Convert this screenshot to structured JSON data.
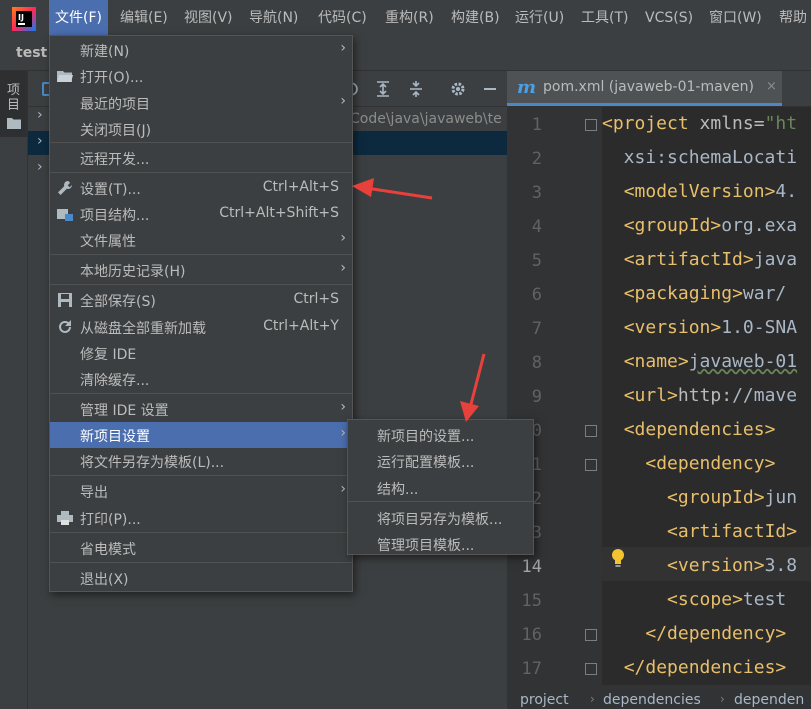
{
  "menubar": {
    "items": [
      "文件(F)",
      "编辑(E)",
      "视图(V)",
      "导航(N)",
      "代码(C)",
      "重构(R)",
      "构建(B)",
      "运行(U)",
      "工具(T)",
      "VCS(S)",
      "窗口(W)",
      "帮助"
    ],
    "active_index": 0
  },
  "toolbar": {
    "project_name": "test"
  },
  "left_strip": {
    "tool_label": "项目"
  },
  "project_panel": {
    "path_fragment": "Code\\java\\javaweb\\te"
  },
  "file_menu": {
    "items": [
      {
        "label": "新建(N)",
        "shortcut": "",
        "submenu": true,
        "icon": ""
      },
      {
        "label": "打开(O)...",
        "shortcut": "",
        "submenu": false,
        "icon": "folder-open-icon"
      },
      {
        "label": "最近的项目",
        "shortcut": "",
        "submenu": true,
        "icon": ""
      },
      {
        "label": "关闭项目(J)",
        "shortcut": "",
        "submenu": false,
        "icon": ""
      },
      {
        "label": "远程开发...",
        "shortcut": "",
        "submenu": false,
        "icon": ""
      },
      {
        "label": "设置(T)...",
        "shortcut": "Ctrl+Alt+S",
        "submenu": false,
        "icon": "wrench-icon"
      },
      {
        "label": "项目结构...",
        "shortcut": "Ctrl+Alt+Shift+S",
        "submenu": false,
        "icon": "project-structure-icon"
      },
      {
        "label": "文件属性",
        "shortcut": "",
        "submenu": true,
        "icon": ""
      },
      {
        "label": "本地历史记录(H)",
        "shortcut": "",
        "submenu": true,
        "icon": ""
      },
      {
        "label": "全部保存(S)",
        "shortcut": "Ctrl+S",
        "submenu": false,
        "icon": "save-icon"
      },
      {
        "label": "从磁盘全部重新加载",
        "shortcut": "Ctrl+Alt+Y",
        "submenu": false,
        "icon": "reload-icon"
      },
      {
        "label": "修复 IDE",
        "shortcut": "",
        "submenu": false,
        "icon": ""
      },
      {
        "label": "清除缓存...",
        "shortcut": "",
        "submenu": false,
        "icon": ""
      },
      {
        "label": "管理 IDE 设置",
        "shortcut": "",
        "submenu": true,
        "icon": ""
      },
      {
        "label": "新项目设置",
        "shortcut": "",
        "submenu": true,
        "icon": ""
      },
      {
        "label": "将文件另存为模板(L)...",
        "shortcut": "",
        "submenu": false,
        "icon": ""
      },
      {
        "label": "导出",
        "shortcut": "",
        "submenu": true,
        "icon": ""
      },
      {
        "label": "打印(P)...",
        "shortcut": "",
        "submenu": false,
        "icon": "print-icon"
      },
      {
        "label": "省电模式",
        "shortcut": "",
        "submenu": false,
        "icon": ""
      },
      {
        "label": "退出(X)",
        "shortcut": "",
        "submenu": false,
        "icon": ""
      }
    ],
    "selected_index": 14
  },
  "submenu": {
    "items": [
      "新项目的设置...",
      "运行配置模板...",
      "结构...",
      "将项目另存为模板...",
      "管理项目模板..."
    ]
  },
  "editor": {
    "tab_label": "pom.xml (javaweb-01-maven)",
    "current_line": 14,
    "lines": [
      {
        "n": 1,
        "code": "<project xmlns=\"ht"
      },
      {
        "n": 2,
        "code": "  xsi:schemaLocati"
      },
      {
        "n": 3,
        "code": "  <modelVersion>4."
      },
      {
        "n": 4,
        "code": "  <groupId>org.exa"
      },
      {
        "n": 5,
        "code": "  <artifactId>java"
      },
      {
        "n": 6,
        "code": "  <packaging>war</"
      },
      {
        "n": 7,
        "code": "  <version>1.0-SNA"
      },
      {
        "n": 8,
        "code": "  <name>javaweb-01"
      },
      {
        "n": 9,
        "code": "  <url>http://mave"
      },
      {
        "n": 10,
        "code": "  <dependencies>"
      },
      {
        "n": 11,
        "code": "    <dependency>"
      },
      {
        "n": 12,
        "code": "      <groupId>jun"
      },
      {
        "n": 13,
        "code": "      <artifactId>"
      },
      {
        "n": 14,
        "code": "      <version>3.8"
      },
      {
        "n": 15,
        "code": "      <scope>test<"
      },
      {
        "n": 16,
        "code": "    </dependency>"
      },
      {
        "n": 17,
        "code": "  </dependencies>"
      }
    ]
  },
  "breadcrumb": [
    "project",
    "dependencies",
    "dependen"
  ],
  "colors": {
    "accent": "#4b6eaf",
    "arrow": "#e8403a",
    "bg": "#2b2b2b",
    "panel": "#3c3f41"
  }
}
